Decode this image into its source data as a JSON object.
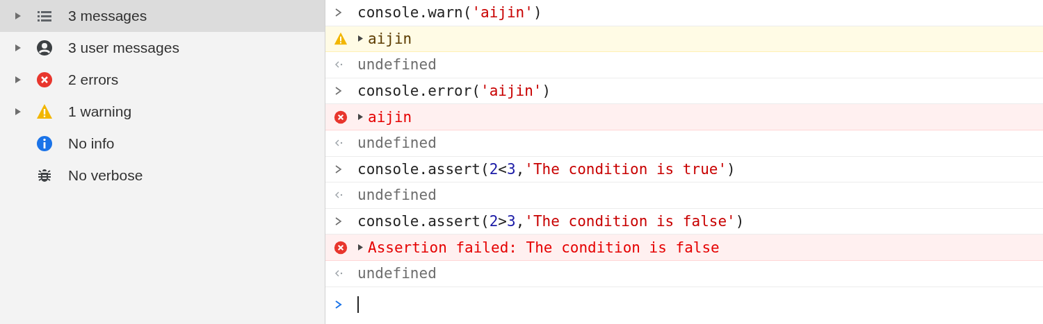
{
  "sidebar": {
    "items": [
      {
        "label": "3 messages",
        "kind": "list",
        "expandable": true,
        "selected": true
      },
      {
        "label": "3 user messages",
        "kind": "user",
        "expandable": true,
        "selected": false
      },
      {
        "label": "2 errors",
        "kind": "error",
        "expandable": true,
        "selected": false
      },
      {
        "label": "1 warning",
        "kind": "warning",
        "expandable": true,
        "selected": false
      },
      {
        "label": "No info",
        "kind": "info",
        "expandable": false,
        "selected": false
      },
      {
        "label": "No verbose",
        "kind": "verbose",
        "expandable": false,
        "selected": false
      }
    ]
  },
  "console": {
    "entries": [
      {
        "kind": "input",
        "parts": [
          {
            "kind": "code",
            "text": "console.warn("
          },
          {
            "kind": "string",
            "text": "'aijin'"
          },
          {
            "kind": "code",
            "text": ")"
          }
        ]
      },
      {
        "kind": "warning",
        "parts": [
          {
            "kind": "message",
            "text": "aijin"
          }
        ]
      },
      {
        "kind": "result",
        "parts": [
          {
            "kind": "value",
            "text": "undefined"
          }
        ]
      },
      {
        "kind": "input",
        "parts": [
          {
            "kind": "code",
            "text": "console.error("
          },
          {
            "kind": "string",
            "text": "'aijin'"
          },
          {
            "kind": "code",
            "text": ")"
          }
        ]
      },
      {
        "kind": "error",
        "parts": [
          {
            "kind": "message",
            "text": "aijin"
          }
        ]
      },
      {
        "kind": "result",
        "parts": [
          {
            "kind": "value",
            "text": "undefined"
          }
        ]
      },
      {
        "kind": "input",
        "parts": [
          {
            "kind": "code",
            "text": "console.assert("
          },
          {
            "kind": "number",
            "text": "2"
          },
          {
            "kind": "code",
            "text": "<"
          },
          {
            "kind": "number",
            "text": "3"
          },
          {
            "kind": "code",
            "text": ","
          },
          {
            "kind": "string",
            "text": "'The condition is true'"
          },
          {
            "kind": "code",
            "text": ")"
          }
        ]
      },
      {
        "kind": "result",
        "parts": [
          {
            "kind": "value",
            "text": "undefined"
          }
        ]
      },
      {
        "kind": "input",
        "parts": [
          {
            "kind": "code",
            "text": "console.assert("
          },
          {
            "kind": "number",
            "text": "2"
          },
          {
            "kind": "code",
            "text": ">"
          },
          {
            "kind": "number",
            "text": "3"
          },
          {
            "kind": "code",
            "text": ","
          },
          {
            "kind": "string",
            "text": "'The condition is false'"
          },
          {
            "kind": "code",
            "text": ")"
          }
        ]
      },
      {
        "kind": "error",
        "parts": [
          {
            "kind": "message",
            "text": "Assertion failed: The condition is false"
          }
        ]
      },
      {
        "kind": "result",
        "parts": [
          {
            "kind": "value",
            "text": "undefined"
          }
        ]
      },
      {
        "kind": "prompt"
      }
    ]
  }
}
